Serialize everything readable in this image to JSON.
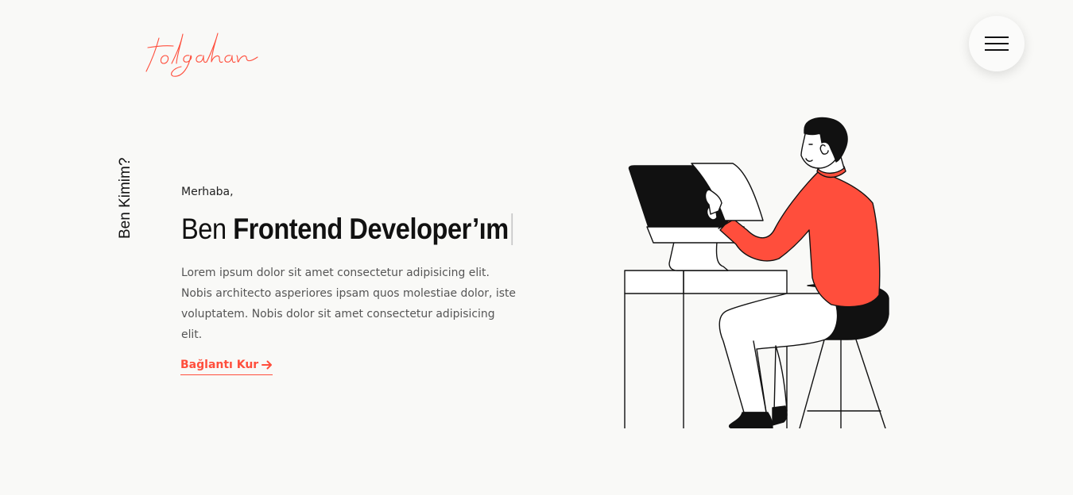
{
  "header": {
    "logo_text": "tolgahan",
    "menu_icon": "hamburger-menu-icon"
  },
  "hero": {
    "side_label": "Ben Kimim?",
    "greeting": "Merhaba,",
    "headline_prefix": "Ben ",
    "headline_role": "Frontend Developer’ım",
    "description": "Lorem ipsum dolor sit amet consectetur adipisicing elit. Nobis architecto asperiores ipsam quos molestiae dolor, iste voluptatem. Nobis dolor sit amet consectetur adipisicing elit.",
    "cta_label": "Bağlantı Kur",
    "cta_icon": "arrow-right-icon"
  },
  "colors": {
    "accent": "#ff4e3c",
    "background": "#f9f9f7",
    "text": "#111111"
  }
}
